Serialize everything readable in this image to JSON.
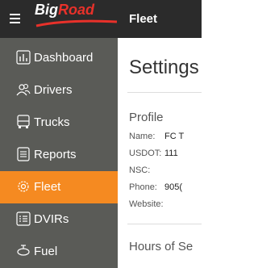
{
  "header": {
    "logo_big": "Big",
    "logo_road": "Road",
    "page_title": "Fleet"
  },
  "sidebar": {
    "items": [
      {
        "label": "Dashboard",
        "icon": "bar-chart-icon"
      },
      {
        "label": "Drivers",
        "icon": "users-icon"
      },
      {
        "label": "Trucks",
        "icon": "truck-icon"
      },
      {
        "label": "Reports",
        "icon": "document-icon"
      },
      {
        "label": "Fleet",
        "icon": "gear-icon",
        "active": true
      },
      {
        "label": "DVIRs",
        "icon": "list-icon"
      },
      {
        "label": "Fuel",
        "icon": "fuel-icon"
      }
    ]
  },
  "main": {
    "title": "Settings",
    "profile": {
      "section_title": "Profile",
      "fields": [
        {
          "label": "Name:",
          "value": "FC T"
        },
        {
          "label": "USDOT:",
          "value": "111"
        },
        {
          "label": "NSC:",
          "value": ""
        },
        {
          "label": "Phone:",
          "value": "905("
        },
        {
          "label": "Website:",
          "value": ""
        }
      ]
    },
    "hours_section_title": "Hours of Se"
  },
  "colors": {
    "topbar": "#2b2b2b",
    "sidebar": "#5a5b57",
    "active": "#f58a21",
    "brand_red": "#e8312a"
  }
}
